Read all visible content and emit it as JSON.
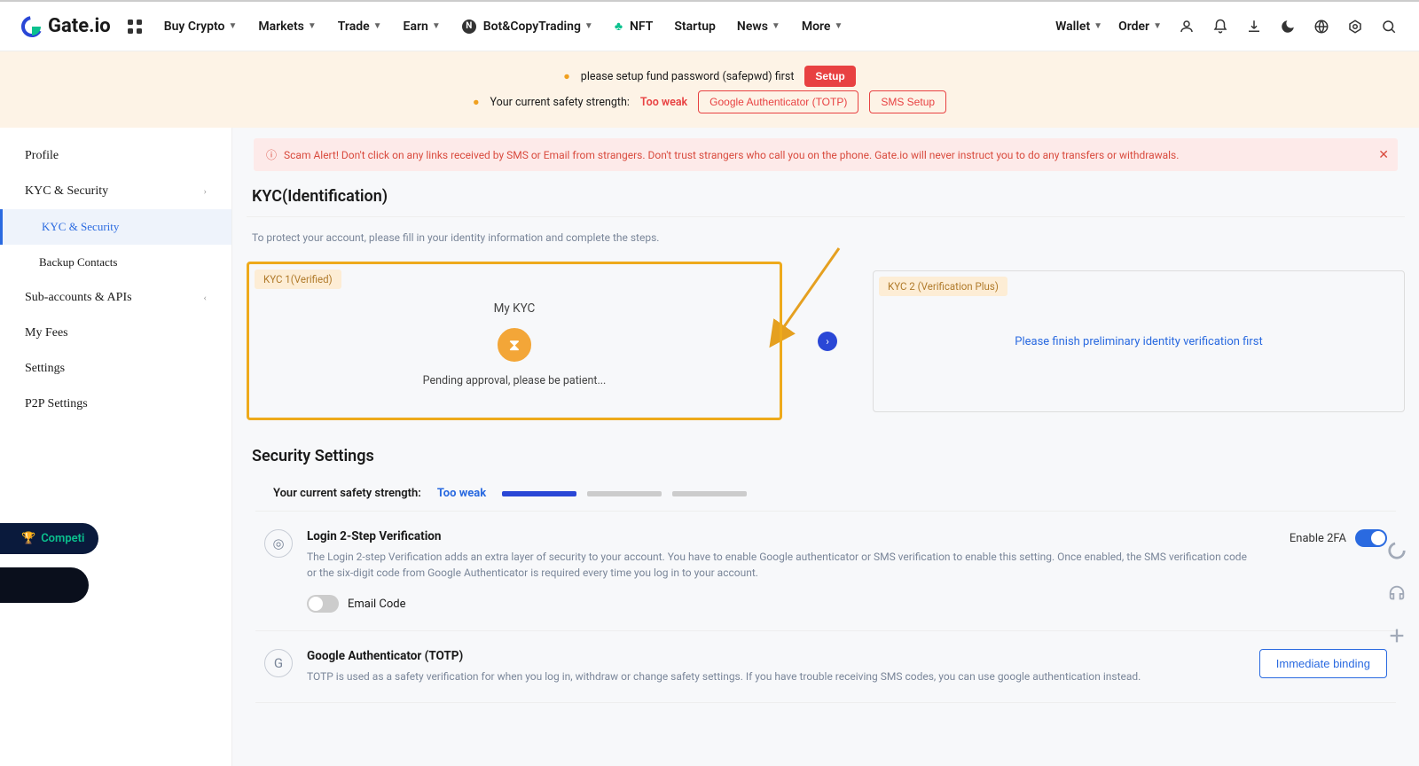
{
  "brand": "Gate.io",
  "nav": {
    "items": [
      "Buy Crypto",
      "Markets",
      "Trade",
      "Earn",
      "Bot&CopyTrading",
      "NFT",
      "Startup",
      "News",
      "More"
    ],
    "right": [
      "Wallet",
      "Order"
    ]
  },
  "banner": {
    "fund_pwd": "please setup fund password (safepwd) first",
    "setup": "Setup",
    "safety_label": "Your current safety strength:",
    "safety_value": "Too weak",
    "totp_btn": "Google Authenticator (TOTP)",
    "sms_btn": "SMS Setup"
  },
  "sidebar": {
    "profile": "Profile",
    "kyc_sec": "KYC & Security",
    "kyc_sec_sub": "KYC & Security",
    "backup": "Backup Contacts",
    "subaccounts": "Sub-accounts & APIs",
    "my_fees": "My Fees",
    "settings": "Settings",
    "p2p": "P2P Settings"
  },
  "scam_alert": "Scam Alert! Don't click on any links received by SMS or Email from strangers. Don't trust strangers who call you on the phone. Gate.io will never instruct you to do any transfers or withdrawals.",
  "kyc": {
    "title": "KYC(Identification)",
    "sub": "To protect your account, please fill in your identity information and complete the steps.",
    "card1_badge": "KYC 1(Verified)",
    "card1_heading": "My KYC",
    "card1_status": "Pending approval, please be patient...",
    "card2_badge": "KYC 2 (Verification Plus)",
    "card2_text": "Please finish preliminary identity verification first"
  },
  "security": {
    "title": "Security Settings",
    "strength_label": "Your current safety strength:",
    "strength_value": "Too weak",
    "login_2step_title": "Login 2-Step Verification",
    "login_2step_desc": "The Login 2-step Verification adds an extra layer of security to your account. You have to enable Google authenticator or SMS verification to enable this setting. Once enabled, the SMS verification code or the six-digit code from Google Authenticator is required every time you log in to your account.",
    "enable_2fa": "Enable 2FA",
    "email_code": "Email Code",
    "totp_title": "Google Authenticator (TOTP)",
    "totp_desc": "TOTP is used as a safety verification for when you log in, withdraw or change safety settings. If you have trouble receiving SMS codes, you can use google authentication instead.",
    "immediate_binding": "Immediate binding"
  },
  "float": {
    "compet": "Competi"
  }
}
